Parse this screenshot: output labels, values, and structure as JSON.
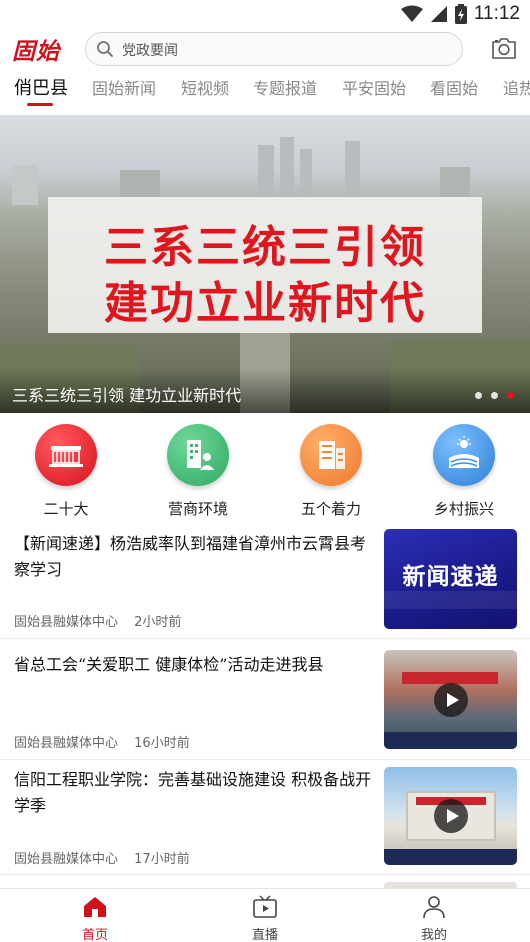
{
  "status_bar": {
    "time": "11:12"
  },
  "header": {
    "logo_text": "固始",
    "search_placeholder": "党政要闻"
  },
  "tabs": [
    {
      "label": "俏巴县",
      "active": true
    },
    {
      "label": "固始新闻"
    },
    {
      "label": "短视频"
    },
    {
      "label": "专题报道"
    },
    {
      "label": "平安固始"
    },
    {
      "label": "看固始"
    },
    {
      "label": "追热"
    }
  ],
  "banner": {
    "poster_line1": "三系三统三引领",
    "poster_line2": "建功立业新时代",
    "caption": "三系三统三引领 建功立业新时代",
    "slide_count": 3,
    "active_slide": 3
  },
  "quick_entries": [
    {
      "label": "二十大",
      "icon": "building-icon",
      "color": "#e0161f"
    },
    {
      "label": "营商环境",
      "icon": "business-icon",
      "color": "#3cb371"
    },
    {
      "label": "五个着力",
      "icon": "office-icon",
      "color": "#f2873a"
    },
    {
      "label": "乡村振兴",
      "icon": "countryside-icon",
      "color": "#3d8fe0"
    }
  ],
  "news": [
    {
      "title": "【新闻速递】杨浩威率队到福建省漳州市云霄县考察学习",
      "source": "固始县融媒体中心",
      "time": "2小时前",
      "thumb_text": "新闻速递",
      "video": false
    },
    {
      "title": "省总工会“关爱职工 健康体检”活动走进我县",
      "source": "固始县融媒体中心",
      "time": "16小时前",
      "video": true
    },
    {
      "title": "信阳工程职业学院：完善基础设施建设 积极备战开学季",
      "source": "固始县融媒体中心",
      "time": "17小时前",
      "video": true
    }
  ],
  "bottom_nav": [
    {
      "label": "首页",
      "active": true
    },
    {
      "label": "直播"
    },
    {
      "label": "我的"
    }
  ],
  "colors": {
    "brand": "#d0121b",
    "text": "#222222",
    "meta": "#666666"
  }
}
